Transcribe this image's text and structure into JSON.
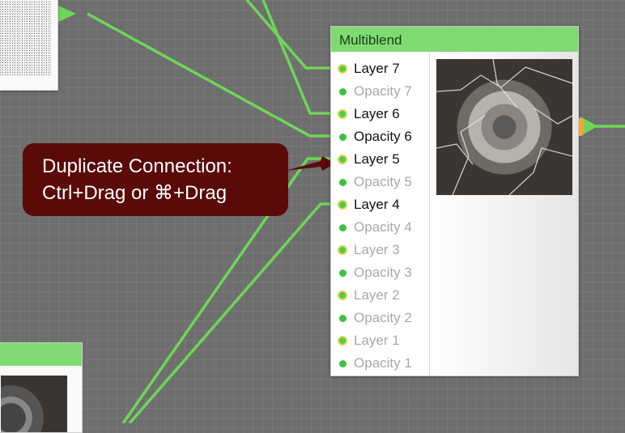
{
  "multiblend_node": {
    "title": "Multiblend",
    "ports": [
      {
        "label": "Layer 7",
        "kind": "layer",
        "connected": true
      },
      {
        "label": "Opacity 7",
        "kind": "opacity",
        "connected": false
      },
      {
        "label": "Layer 6",
        "kind": "layer",
        "connected": true
      },
      {
        "label": "Opacity 6",
        "kind": "opacity",
        "connected": true
      },
      {
        "label": "Layer 5",
        "kind": "layer",
        "connected": true
      },
      {
        "label": "Opacity 5",
        "kind": "opacity",
        "connected": false
      },
      {
        "label": "Layer 4",
        "kind": "layer",
        "connected": true
      },
      {
        "label": "Opacity 4",
        "kind": "opacity",
        "connected": false
      },
      {
        "label": "Layer 3",
        "kind": "layer",
        "connected": false
      },
      {
        "label": "Opacity 3",
        "kind": "opacity",
        "connected": false
      },
      {
        "label": "Layer 2",
        "kind": "layer",
        "connected": false
      },
      {
        "label": "Opacity 2",
        "kind": "opacity",
        "connected": false
      },
      {
        "label": "Layer 1",
        "kind": "layer",
        "connected": false
      },
      {
        "label": "Opacity 1",
        "kind": "opacity",
        "connected": false
      }
    ]
  },
  "tooltip": {
    "line1": "Duplicate Connection:",
    "line2": "Ctrl+Drag or  ⌘+Drag"
  },
  "colors": {
    "canvas_bg": "#6e6e6e",
    "wire": "#6ed657",
    "node_header": "#7fda72",
    "tooltip_bg": "#5a0a09",
    "tooltip_arrow": "#5a0a09",
    "output_port": "#f4a63a"
  }
}
